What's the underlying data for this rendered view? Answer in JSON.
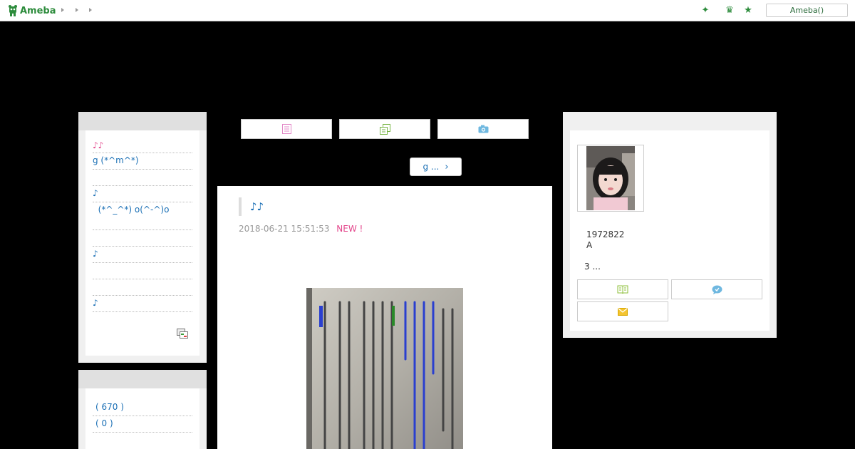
{
  "header": {
    "logo_text": "Ameba",
    "account_button": "Ameba()",
    "icons": [
      "sparkle-icon",
      "crown-icon",
      "star-icon"
    ]
  },
  "left_sidebar": {
    "recent_entries": [
      "♪♪",
      "g  (*^m^*)",
      "",
      "♪",
      "  (*^_^*) o(^-^)o",
      "",
      "♪",
      "",
      "",
      "♪"
    ],
    "stats": [
      "( 670 )",
      "( 0 )"
    ]
  },
  "center": {
    "tabs": [
      "document-icon",
      "copy-icon",
      "camera-icon"
    ],
    "next_link": "g ...",
    "article": {
      "title": "♪♪",
      "date": "2018-06-21 15:51:53",
      "new_badge": "NEW !"
    }
  },
  "profile": {
    "id_number": "1972822",
    "line2": "A",
    "line3": "3 ...",
    "buttons": [
      "book-icon",
      "chat-icon",
      "mail-icon"
    ]
  },
  "colors": {
    "accent_green": "#2d8c3c",
    "link_blue": "#1a6fb5",
    "new_pink": "#e3458b"
  }
}
